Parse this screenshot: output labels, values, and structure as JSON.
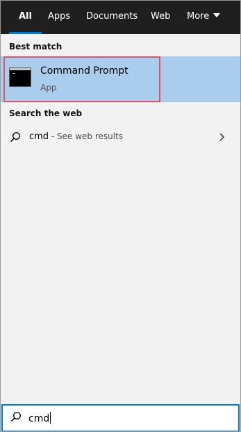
{
  "tabs": [
    {
      "label": "All",
      "active": true
    },
    {
      "label": "Apps",
      "active": false
    },
    {
      "label": "Documents",
      "active": false
    },
    {
      "label": "Web",
      "active": false
    },
    {
      "label": "More",
      "active": false
    }
  ],
  "best_match": {
    "heading": "Best match",
    "title": "Command Prompt",
    "subtitle": "App"
  },
  "web": {
    "heading": "Search the web",
    "query": "cmd",
    "hint": " - See web results"
  },
  "search": {
    "value": "cmd"
  },
  "colors": {
    "topbar": "#1f1f1f",
    "accent": "#0078d7",
    "selection": "#aacdee",
    "highlight_border": "#e0526a"
  },
  "icons": {
    "command_prompt": "command-prompt-icon",
    "web_search": "search-icon",
    "chevron": "chevron-right-icon",
    "search_box": "search-icon",
    "more_caret": "caret-down-icon"
  }
}
